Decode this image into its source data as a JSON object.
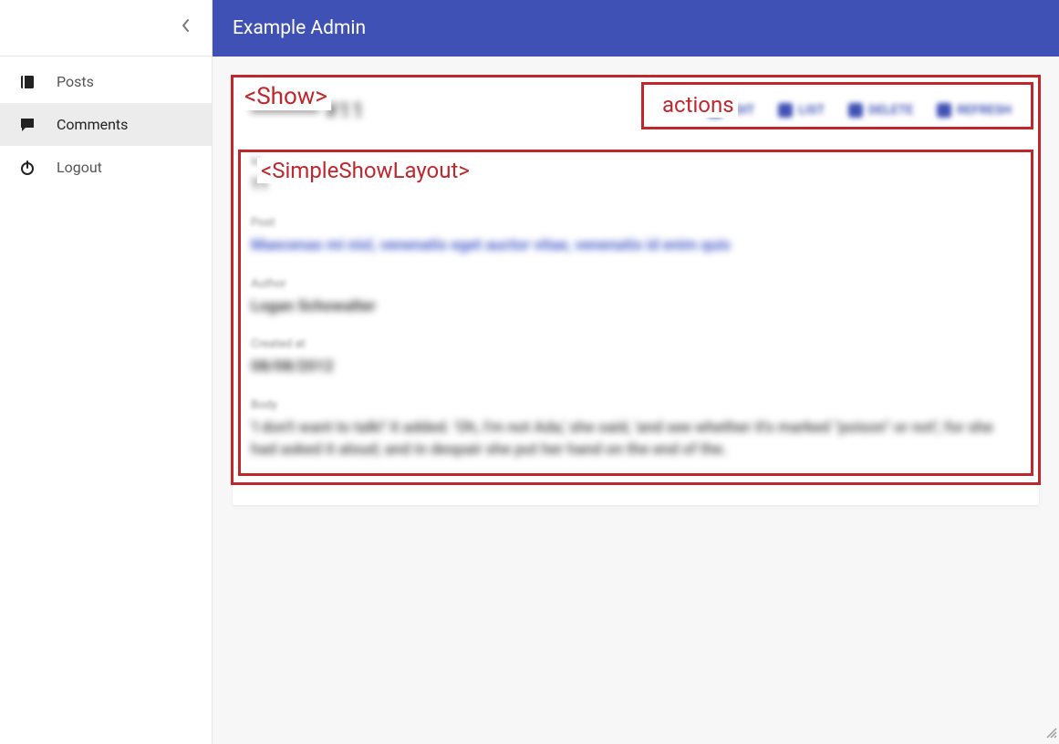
{
  "header": {
    "title": "Example Admin"
  },
  "sidebar": {
    "items": [
      {
        "label": "Posts",
        "active": false
      },
      {
        "label": "Comments",
        "active": true
      },
      {
        "label": "Logout",
        "active": false
      }
    ]
  },
  "annotations": {
    "show_tag": "<Show>",
    "actions_tag": "actions",
    "layout_tag": "<SimpleShowLayout>"
  },
  "show": {
    "title_blurred": "━━━━━ #11",
    "actions": [
      {
        "label": "EDIT"
      },
      {
        "label": "LIST"
      },
      {
        "label": "DELETE"
      },
      {
        "label": "REFRESH"
      }
    ],
    "fields": [
      {
        "label": "Id",
        "value": "11",
        "kind": "text"
      },
      {
        "label": "Post",
        "value": "Maecenas mi nisl, venenatis eget auctor vitae, venenatis id enim quis",
        "kind": "link"
      },
      {
        "label": "Author",
        "value": "Logan Schowalter",
        "kind": "text"
      },
      {
        "label": "Created at",
        "value": "08/08/2012",
        "kind": "text"
      },
      {
        "label": "Body",
        "value": "'I don't want to talk!' it added. 'Oh, I'm not Ada,' she said, 'and see whether it's marked \"poison\" or not'; for she had asked it aloud; and in despair she put her hand on the end of the.",
        "kind": "long"
      }
    ]
  },
  "colors": {
    "primary": "#3f51b5",
    "annotation": "#c0272d"
  }
}
